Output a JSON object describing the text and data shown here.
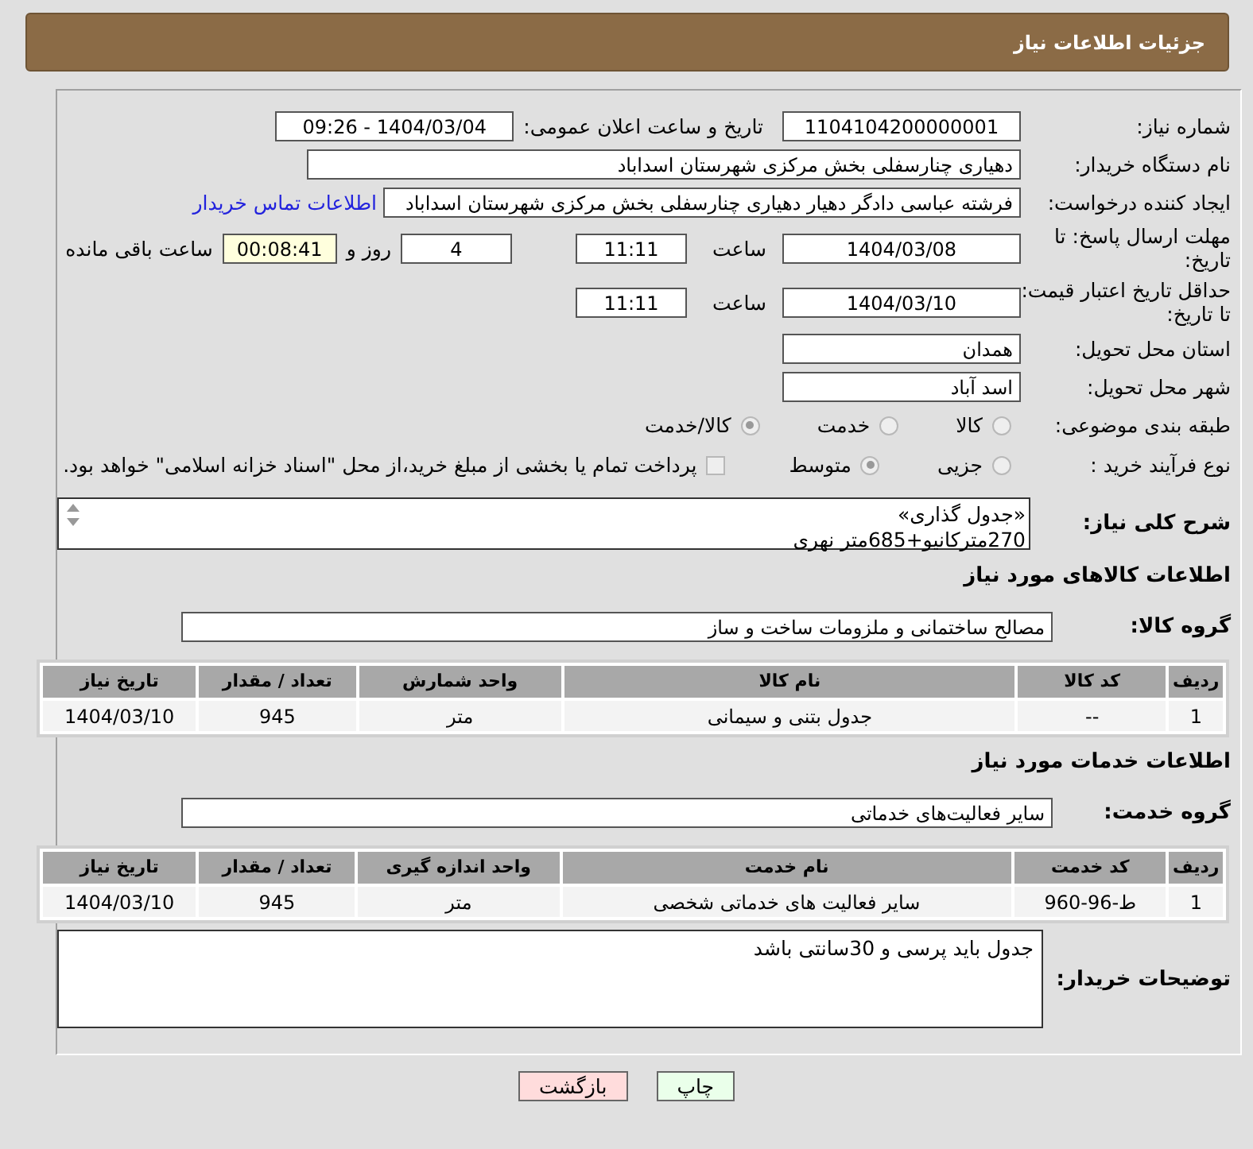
{
  "header": {
    "title": "جزئیات اطلاعات نیاز"
  },
  "need_number": {
    "label": "شماره نیاز:",
    "value": "1104104200000001"
  },
  "announce": {
    "label": "تاریخ و ساعت اعلان عمومی:",
    "value": "1404/03/04 - 09:26"
  },
  "buyer": {
    "label": "نام دستگاه خریدار:",
    "value": "دهیاری چنارسفلی بخش مرکزی شهرستان اسداباد"
  },
  "creator": {
    "label": "ایجاد کننده درخواست:",
    "value": "فرشته عباسی دادگر دهیار دهیاری چنارسفلی بخش مرکزی شهرستان اسداباد",
    "link": "اطلاعات تماس خریدار"
  },
  "deadline": {
    "label": "مهلت ارسال پاسخ: تا تاریخ:",
    "date": "1404/03/08",
    "time_label": "ساعت",
    "time": "11:11",
    "days": "4",
    "days_label": "روز و",
    "remaining": "00:08:41",
    "remaining_label": "ساعت باقی مانده"
  },
  "validity": {
    "label": "حداقل تاریخ اعتبار قیمت: تا تاریخ:",
    "date": "1404/03/10",
    "time_label": "ساعت",
    "time": "11:11"
  },
  "province": {
    "label": "استان محل تحویل:",
    "value": "همدان"
  },
  "city": {
    "label": "شهر محل تحویل:",
    "value": "اسد آباد"
  },
  "category": {
    "label": "طبقه بندی موضوعی:",
    "options": [
      {
        "label": "کالا",
        "selected": false
      },
      {
        "label": "خدمت",
        "selected": false
      },
      {
        "label": "کالا/خدمت",
        "selected": true
      }
    ]
  },
  "process": {
    "label": "نوع فرآیند خرید :",
    "options": [
      {
        "label": "جزیی",
        "selected": false
      },
      {
        "label": "متوسط",
        "selected": true
      }
    ],
    "payment": {
      "label": "پرداخت تمام یا بخشی از مبلغ خرید،از محل \"اسناد خزانه اسلامی\" خواهد بود.",
      "checked": false
    }
  },
  "description": {
    "label": "شرح کلی نیاز:",
    "lines": [
      "«جدول گذاری»",
      "270مترکانیو+685متر نهری"
    ]
  },
  "goods": {
    "title": "اطلاعات کالاهای مورد نیاز",
    "group_label": "گروه کالا:",
    "group_value": "مصالح ساختمانی و ملزومات ساخت و ساز",
    "columns": [
      "ردیف",
      "کد کالا",
      "نام کالا",
      "واحد شمارش",
      "تعداد / مقدار",
      "تاریخ نیاز"
    ],
    "rows": [
      [
        "1",
        "--",
        "جدول بتنی و سیمانی",
        "متر",
        "945",
        "1404/03/10"
      ]
    ]
  },
  "services": {
    "title": "اطلاعات خدمات مورد نیاز",
    "group_label": "گروه خدمت:",
    "group_value": "سایر فعالیت‌های خدماتی",
    "columns": [
      "ردیف",
      "کد خدمت",
      "نام خدمت",
      "واحد اندازه گیری",
      "تعداد / مقدار",
      "تاریخ نیاز"
    ],
    "rows": [
      [
        "1",
        "ط-96-960",
        "سایر فعالیت های خدماتی شخصی",
        "متر",
        "945",
        "1404/03/10"
      ]
    ]
  },
  "notes": {
    "label": "توضیحات خریدار:",
    "value": "جدول باید پرسی و 30سانتی باشد"
  },
  "buttons": [
    {
      "label": "چاپ",
      "kind": "print"
    },
    {
      "label": "بازگشت",
      "kind": "back"
    }
  ]
}
